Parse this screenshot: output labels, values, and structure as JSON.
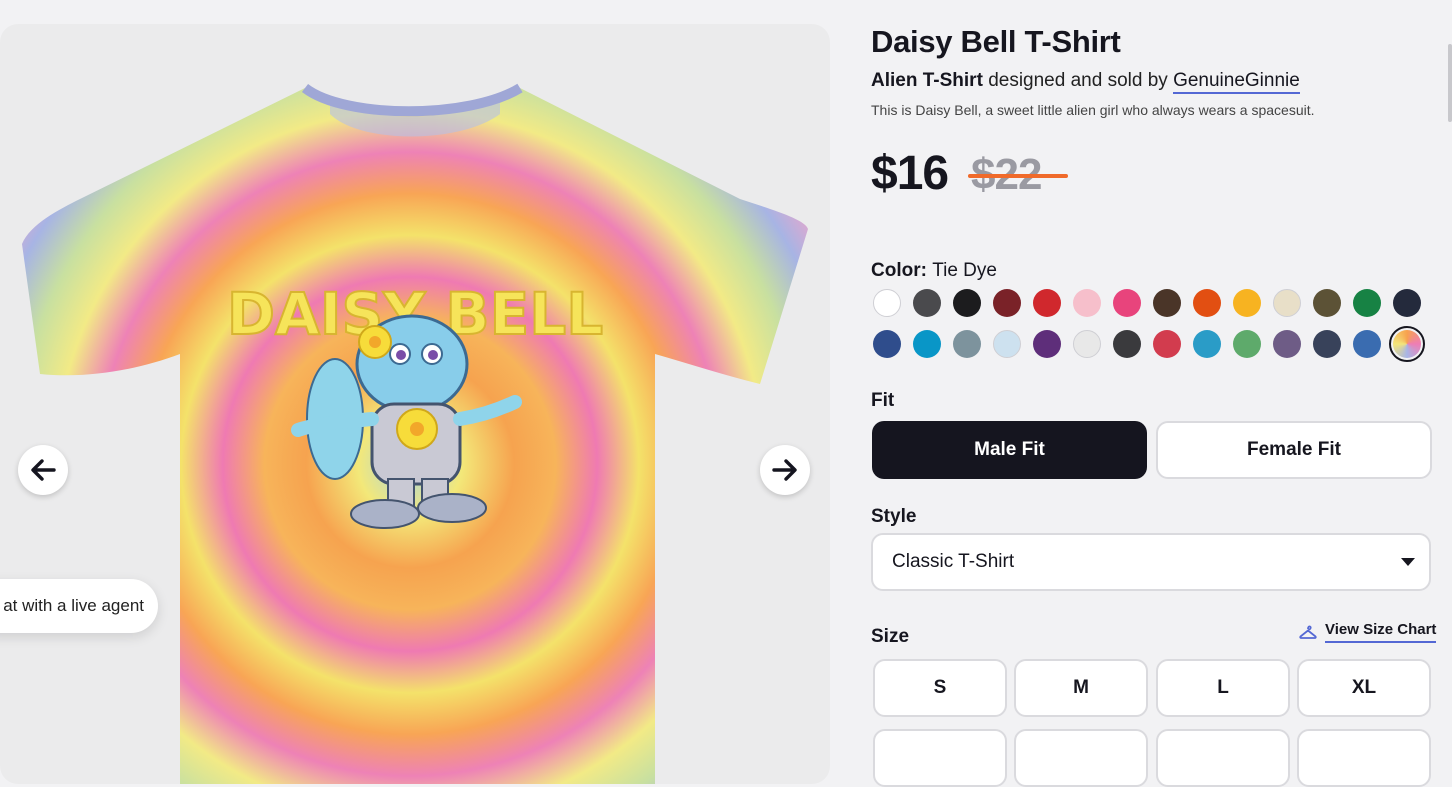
{
  "product": {
    "title": "Daisy Bell T-Shirt",
    "product_type": "Alien T-Shirt",
    "byline_mid": "designed and sold by",
    "artist": "GenuineGinnie",
    "description": "This is Daisy Bell, a sweet little alien girl who always wears a spacesuit.",
    "price": "$16",
    "original_price": "$22"
  },
  "image": {
    "printed_text": "DAISY BELL"
  },
  "chat": {
    "label": "at with a live agent"
  },
  "color": {
    "label": "Color:",
    "selected": "Tie Dye",
    "swatches": [
      {
        "name": "white",
        "hex": "#ffffff"
      },
      {
        "name": "charcoal",
        "hex": "#4a4a4d"
      },
      {
        "name": "black",
        "hex": "#1c1c1e"
      },
      {
        "name": "maroon",
        "hex": "#7a2228"
      },
      {
        "name": "red",
        "hex": "#d0282d"
      },
      {
        "name": "light-pink",
        "hex": "#f6bfcb"
      },
      {
        "name": "hot-pink",
        "hex": "#e8447c"
      },
      {
        "name": "brown",
        "hex": "#4a3528"
      },
      {
        "name": "orange",
        "hex": "#e24f12"
      },
      {
        "name": "gold",
        "hex": "#f7b321"
      },
      {
        "name": "cream",
        "hex": "#e8dfc8"
      },
      {
        "name": "olive",
        "hex": "#5c5236"
      },
      {
        "name": "kelly-green",
        "hex": "#178244"
      },
      {
        "name": "navy",
        "hex": "#242a3c"
      },
      {
        "name": "royal-heather",
        "hex": "#2f4d8c"
      },
      {
        "name": "turquoise",
        "hex": "#0996c7"
      },
      {
        "name": "slate",
        "hex": "#7d939d"
      },
      {
        "name": "light-blue",
        "hex": "#cde1ef"
      },
      {
        "name": "purple",
        "hex": "#5e2e7a"
      },
      {
        "name": "heather-white",
        "hex": "#e8e8e8"
      },
      {
        "name": "dark-heather",
        "hex": "#3a3a3d"
      },
      {
        "name": "heather-red",
        "hex": "#d23c4e"
      },
      {
        "name": "heather-turquoise",
        "hex": "#2a9cc7"
      },
      {
        "name": "heather-green",
        "hex": "#5eaa6b"
      },
      {
        "name": "heather-purple",
        "hex": "#6e5c86"
      },
      {
        "name": "heather-navy",
        "hex": "#38425a"
      },
      {
        "name": "heather-royal",
        "hex": "#3a6cb0"
      },
      {
        "name": "tie-dye",
        "hex": "#f5c05a",
        "selected": true
      }
    ]
  },
  "fit": {
    "label": "Fit",
    "options": [
      "Male Fit",
      "Female Fit"
    ],
    "selected": "Male Fit"
  },
  "style": {
    "label": "Style",
    "value": "Classic T-Shirt"
  },
  "size": {
    "label": "Size",
    "chart_link": "View Size Chart",
    "options": [
      "S",
      "M",
      "L",
      "XL",
      "",
      "",
      "",
      ""
    ]
  }
}
